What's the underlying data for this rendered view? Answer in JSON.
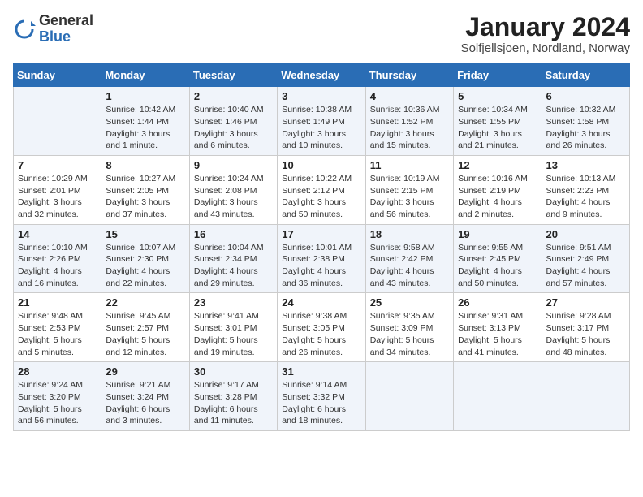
{
  "header": {
    "logo_general": "General",
    "logo_blue": "Blue",
    "month_title": "January 2024",
    "location": "Solfjellsjoen, Nordland, Norway"
  },
  "days_of_week": [
    "Sunday",
    "Monday",
    "Tuesday",
    "Wednesday",
    "Thursday",
    "Friday",
    "Saturday"
  ],
  "weeks": [
    [
      {
        "day": "",
        "info": ""
      },
      {
        "day": "1",
        "info": "Sunrise: 10:42 AM\nSunset: 1:44 PM\nDaylight: 3 hours\nand 1 minute."
      },
      {
        "day": "2",
        "info": "Sunrise: 10:40 AM\nSunset: 1:46 PM\nDaylight: 3 hours\nand 6 minutes."
      },
      {
        "day": "3",
        "info": "Sunrise: 10:38 AM\nSunset: 1:49 PM\nDaylight: 3 hours\nand 10 minutes."
      },
      {
        "day": "4",
        "info": "Sunrise: 10:36 AM\nSunset: 1:52 PM\nDaylight: 3 hours\nand 15 minutes."
      },
      {
        "day": "5",
        "info": "Sunrise: 10:34 AM\nSunset: 1:55 PM\nDaylight: 3 hours\nand 21 minutes."
      },
      {
        "day": "6",
        "info": "Sunrise: 10:32 AM\nSunset: 1:58 PM\nDaylight: 3 hours\nand 26 minutes."
      }
    ],
    [
      {
        "day": "7",
        "info": "Sunrise: 10:29 AM\nSunset: 2:01 PM\nDaylight: 3 hours\nand 32 minutes."
      },
      {
        "day": "8",
        "info": "Sunrise: 10:27 AM\nSunset: 2:05 PM\nDaylight: 3 hours\nand 37 minutes."
      },
      {
        "day": "9",
        "info": "Sunrise: 10:24 AM\nSunset: 2:08 PM\nDaylight: 3 hours\nand 43 minutes."
      },
      {
        "day": "10",
        "info": "Sunrise: 10:22 AM\nSunset: 2:12 PM\nDaylight: 3 hours\nand 50 minutes."
      },
      {
        "day": "11",
        "info": "Sunrise: 10:19 AM\nSunset: 2:15 PM\nDaylight: 3 hours\nand 56 minutes."
      },
      {
        "day": "12",
        "info": "Sunrise: 10:16 AM\nSunset: 2:19 PM\nDaylight: 4 hours\nand 2 minutes."
      },
      {
        "day": "13",
        "info": "Sunrise: 10:13 AM\nSunset: 2:23 PM\nDaylight: 4 hours\nand 9 minutes."
      }
    ],
    [
      {
        "day": "14",
        "info": "Sunrise: 10:10 AM\nSunset: 2:26 PM\nDaylight: 4 hours\nand 16 minutes."
      },
      {
        "day": "15",
        "info": "Sunrise: 10:07 AM\nSunset: 2:30 PM\nDaylight: 4 hours\nand 22 minutes."
      },
      {
        "day": "16",
        "info": "Sunrise: 10:04 AM\nSunset: 2:34 PM\nDaylight: 4 hours\nand 29 minutes."
      },
      {
        "day": "17",
        "info": "Sunrise: 10:01 AM\nSunset: 2:38 PM\nDaylight: 4 hours\nand 36 minutes."
      },
      {
        "day": "18",
        "info": "Sunrise: 9:58 AM\nSunset: 2:42 PM\nDaylight: 4 hours\nand 43 minutes."
      },
      {
        "day": "19",
        "info": "Sunrise: 9:55 AM\nSunset: 2:45 PM\nDaylight: 4 hours\nand 50 minutes."
      },
      {
        "day": "20",
        "info": "Sunrise: 9:51 AM\nSunset: 2:49 PM\nDaylight: 4 hours\nand 57 minutes."
      }
    ],
    [
      {
        "day": "21",
        "info": "Sunrise: 9:48 AM\nSunset: 2:53 PM\nDaylight: 5 hours\nand 5 minutes."
      },
      {
        "day": "22",
        "info": "Sunrise: 9:45 AM\nSunset: 2:57 PM\nDaylight: 5 hours\nand 12 minutes."
      },
      {
        "day": "23",
        "info": "Sunrise: 9:41 AM\nSunset: 3:01 PM\nDaylight: 5 hours\nand 19 minutes."
      },
      {
        "day": "24",
        "info": "Sunrise: 9:38 AM\nSunset: 3:05 PM\nDaylight: 5 hours\nand 26 minutes."
      },
      {
        "day": "25",
        "info": "Sunrise: 9:35 AM\nSunset: 3:09 PM\nDaylight: 5 hours\nand 34 minutes."
      },
      {
        "day": "26",
        "info": "Sunrise: 9:31 AM\nSunset: 3:13 PM\nDaylight: 5 hours\nand 41 minutes."
      },
      {
        "day": "27",
        "info": "Sunrise: 9:28 AM\nSunset: 3:17 PM\nDaylight: 5 hours\nand 48 minutes."
      }
    ],
    [
      {
        "day": "28",
        "info": "Sunrise: 9:24 AM\nSunset: 3:20 PM\nDaylight: 5 hours\nand 56 minutes."
      },
      {
        "day": "29",
        "info": "Sunrise: 9:21 AM\nSunset: 3:24 PM\nDaylight: 6 hours\nand 3 minutes."
      },
      {
        "day": "30",
        "info": "Sunrise: 9:17 AM\nSunset: 3:28 PM\nDaylight: 6 hours\nand 11 minutes."
      },
      {
        "day": "31",
        "info": "Sunrise: 9:14 AM\nSunset: 3:32 PM\nDaylight: 6 hours\nand 18 minutes."
      },
      {
        "day": "",
        "info": ""
      },
      {
        "day": "",
        "info": ""
      },
      {
        "day": "",
        "info": ""
      }
    ]
  ]
}
